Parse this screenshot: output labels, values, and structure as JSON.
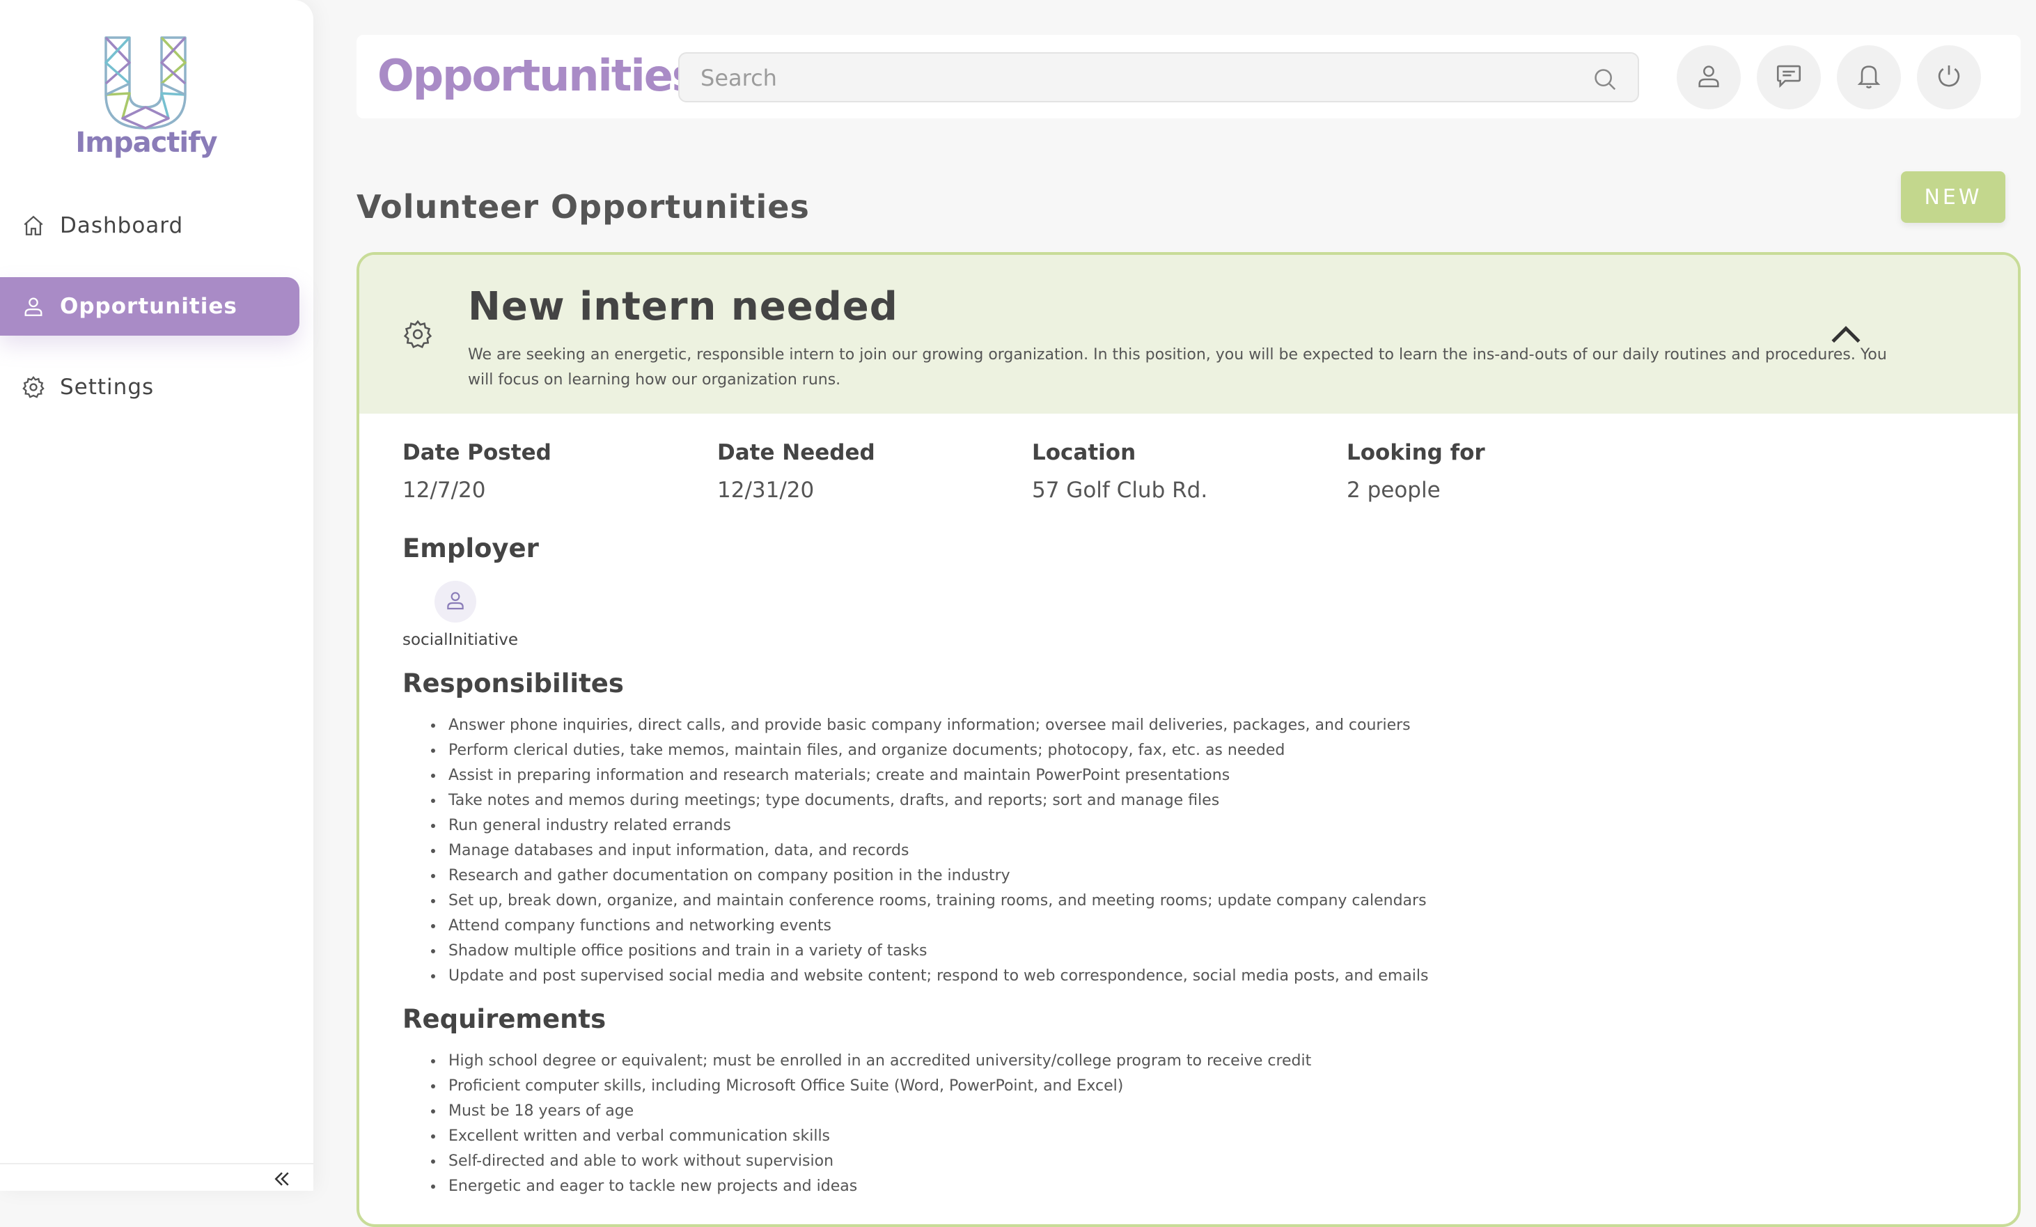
{
  "app": {
    "logo_text": "Impactify"
  },
  "sidebar": {
    "items": [
      {
        "label": "Dashboard",
        "icon": "home-icon",
        "active": false
      },
      {
        "label": "Opportunities",
        "icon": "user-icon",
        "active": true
      },
      {
        "label": "Settings",
        "icon": "gear-icon",
        "active": false
      }
    ]
  },
  "header": {
    "title": "Opportunities",
    "search_placeholder": "Search",
    "search_value": ""
  },
  "main": {
    "section_title": "Volunteer Opportunities",
    "new_button_label": "NEW"
  },
  "opportunity": {
    "title": "New intern needed",
    "description": "We are seeking an energetic, responsible intern to join our growing organization. In this position, you will be expected to learn the ins-and-outs of our daily routines and procedures. You will focus on learning how our organization runs.",
    "fields": [
      {
        "label": "Date Posted",
        "value": "12/7/20"
      },
      {
        "label": "Date Needed",
        "value": "12/31/20"
      },
      {
        "label": "Location",
        "value": "57 Golf Club Rd."
      },
      {
        "label": "Looking for",
        "value": "2 people"
      }
    ],
    "employer_heading": "Employer",
    "employer_name": "socialInitiative",
    "responsibilities_heading": "Responsibilites",
    "responsibilities": [
      "Answer phone inquiries, direct calls, and provide basic company information; oversee mail deliveries, packages, and couriers",
      "Perform clerical duties, take memos, maintain files, and organize documents; photocopy, fax, etc. as needed",
      "Assist in preparing information and research materials; create and maintain PowerPoint presentations",
      "Take notes and memos during meetings; type documents, drafts, and reports; sort and manage files",
      "Run general industry related errands",
      "Manage databases and input information, data, and records",
      "Research and gather documentation on company position in the industry",
      "Set up, break down, organize, and maintain conference rooms, training rooms, and meeting rooms; update company calendars",
      "Attend company functions and networking events",
      "Shadow multiple office positions and train in a variety of tasks",
      "Update and post supervised social media and website content; respond to web correspondence, social media posts, and emails"
    ],
    "requirements_heading": "Requirements",
    "requirements": [
      "High school degree or equivalent; must be enrolled in an accredited university/college program to receive credit",
      "Proficient computer skills, including Microsoft Office Suite (Word, PowerPoint, and Excel)",
      "Must be 18 years of age",
      "Excellent written and verbal communication skills",
      "Self-directed and able to work without supervision",
      "Energetic and eager to tackle new projects and ideas"
    ]
  },
  "colors": {
    "brand_purple": "#a98bc6",
    "accent_green": "#c3d78d",
    "card_header_bg": "#edf2e0"
  }
}
